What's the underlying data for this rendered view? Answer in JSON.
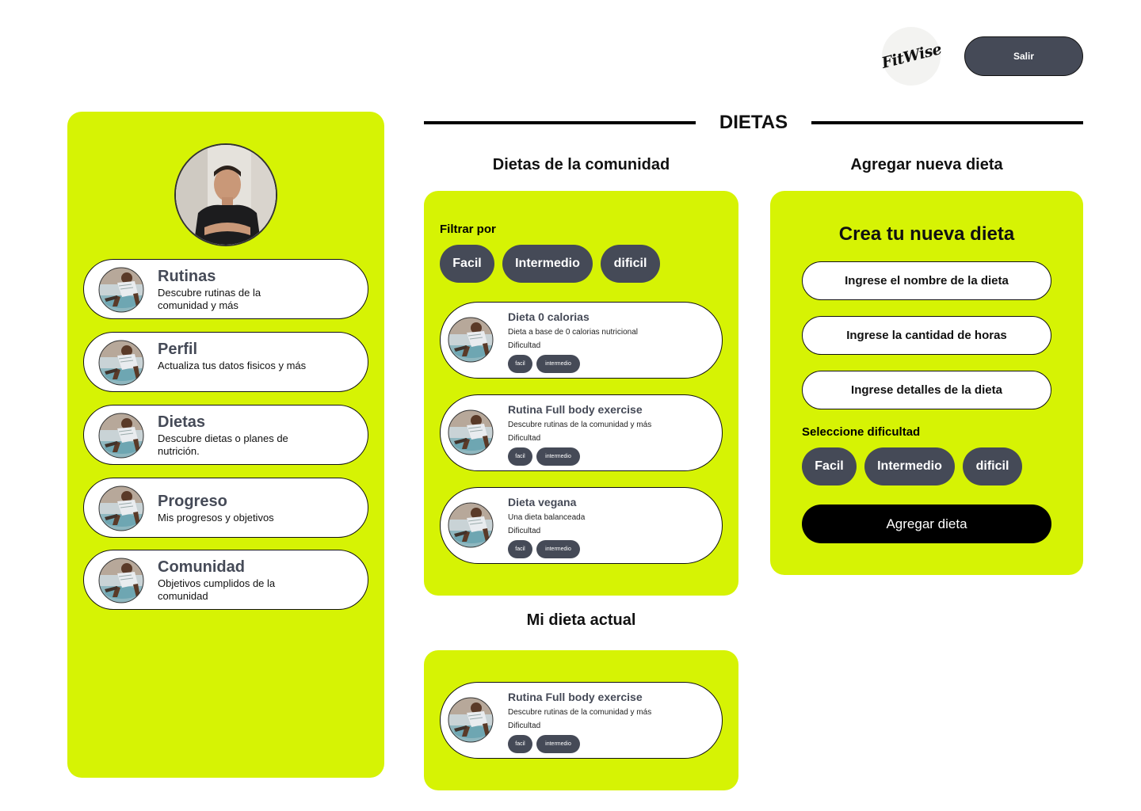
{
  "header": {
    "logo_text": "FitWise",
    "logout_label": "Salir"
  },
  "sidebar": {
    "items": [
      {
        "title": "Rutinas",
        "desc": "Descubre rutinas de la comunidad y más"
      },
      {
        "title": "Perfil",
        "desc": "Actualiza tus datos fisicos y más"
      },
      {
        "title": "Dietas",
        "desc": "Descubre dietas o planes de nutrición."
      },
      {
        "title": "Progreso",
        "desc": "Mis progresos y objetivos"
      },
      {
        "title": "Comunidad",
        "desc": "Objetivos cumplidos de la comunidad"
      }
    ]
  },
  "page": {
    "title": "DIETAS"
  },
  "community": {
    "title": "Dietas  de la comunidad",
    "filter_label": "Filtrar por",
    "filters": [
      "Facil",
      "Intermedio",
      "dificil"
    ],
    "difficulty_label": "Dificultad",
    "tags": [
      "facil",
      "intermedio"
    ],
    "cards": [
      {
        "title": "Dieta 0 calorias",
        "desc": "Dieta a base de  0 calorias nutricional"
      },
      {
        "title": "Rutina Full body exercise",
        "desc": "Descubre rutinas de la comunidad y más"
      },
      {
        "title": "Dieta vegana",
        "desc": "Una dieta balanceada"
      }
    ]
  },
  "current": {
    "title": "Mi dieta actual",
    "card": {
      "title": "Rutina Full body exercise",
      "desc": "Descubre rutinas de la comunidad y más"
    }
  },
  "add": {
    "title": "Agregar nueva dieta",
    "form_title": "Crea tu nueva dieta",
    "name_placeholder": "Ingrese el nombre de la dieta",
    "hours_placeholder": "Ingrese la cantidad de horas",
    "details_placeholder": "Ingrese detalles de la dieta",
    "difficulty_label": "Seleccione dificultad",
    "difficulties": [
      "Facil",
      "Intermedio",
      "dificil"
    ],
    "submit_label": "Agregar dieta"
  },
  "colors": {
    "accent": "#d6f304",
    "dark_pill": "#454a57",
    "text_dark": "#111111"
  }
}
